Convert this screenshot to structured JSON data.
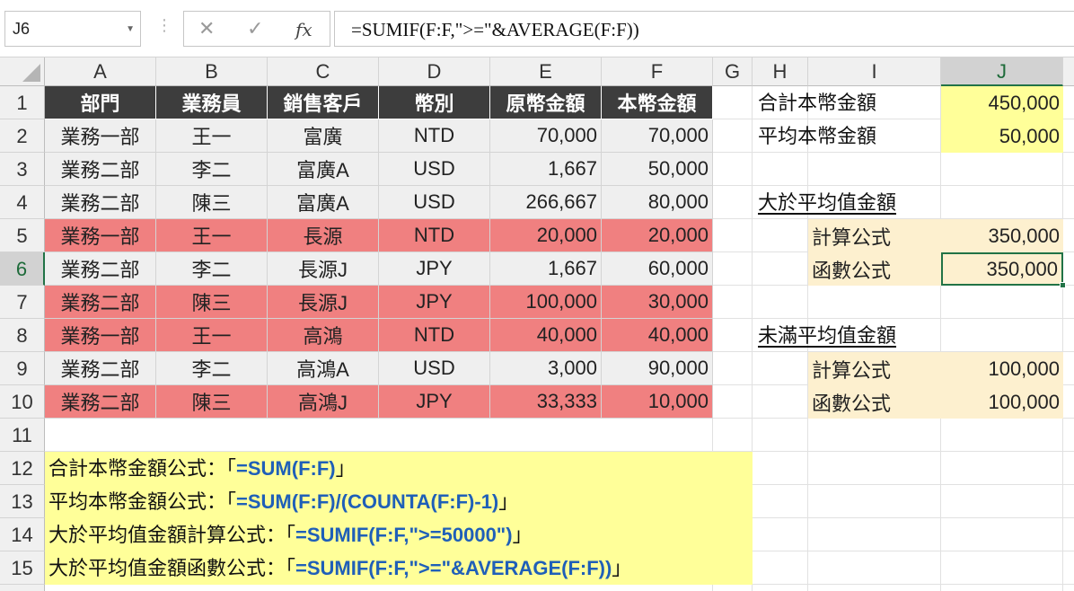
{
  "formula_bar": {
    "name_box": "J6",
    "cancel_icon": "✕",
    "enter_icon": "✓",
    "fx_label": "fx",
    "formula": "=SUMIF(F:F,\">=\"&AVERAGE(F:F))"
  },
  "columns": [
    "A",
    "B",
    "C",
    "D",
    "E",
    "F",
    "G",
    "H",
    "I",
    "J"
  ],
  "rows": [
    "1",
    "2",
    "3",
    "4",
    "5",
    "6",
    "7",
    "8",
    "9",
    "10",
    "11",
    "12",
    "13",
    "14",
    "15"
  ],
  "table": {
    "headers": [
      "部門",
      "業務員",
      "銷售客戶",
      "幣別",
      "原幣金額",
      "本幣金額"
    ],
    "data": [
      [
        "業務一部",
        "王一",
        "富廣",
        "NTD",
        "70,000",
        "70,000"
      ],
      [
        "業務二部",
        "李二",
        "富廣A",
        "USD",
        "1,667",
        "50,000"
      ],
      [
        "業務二部",
        "陳三",
        "富廣A",
        "USD",
        "266,667",
        "80,000"
      ],
      [
        "業務一部",
        "王一",
        "長源",
        "NTD",
        "20,000",
        "20,000"
      ],
      [
        "業務二部",
        "李二",
        "長源J",
        "JPY",
        "1,667",
        "60,000"
      ],
      [
        "業務二部",
        "陳三",
        "長源J",
        "JPY",
        "100,000",
        "30,000"
      ],
      [
        "業務一部",
        "王一",
        "高鴻",
        "NTD",
        "40,000",
        "40,000"
      ],
      [
        "業務二部",
        "李二",
        "高鴻A",
        "USD",
        "3,000",
        "90,000"
      ],
      [
        "業務二部",
        "陳三",
        "高鴻J",
        "JPY",
        "33,333",
        "10,000"
      ]
    ]
  },
  "summary": {
    "total_label": "合計本幣金額",
    "total_value": "450,000",
    "avg_label": "平均本幣金額",
    "avg_value": "50,000",
    "above_heading": "大於平均值金額",
    "above_calc_label": "計算公式",
    "above_calc_value": "350,000",
    "above_func_label": "函數公式",
    "above_func_value": "350,000",
    "below_heading": "未滿平均值金額",
    "below_calc_label": "計算公式",
    "below_calc_value": "100,000",
    "below_func_label": "函數公式",
    "below_func_value": "100,000"
  },
  "notes": [
    {
      "label": "合計本幣金額公式：「",
      "code": "=SUM(F:F)",
      "end": "」"
    },
    {
      "label": "平均本幣金額公式：「",
      "code": "=SUM(F:F)/(COUNTA(F:F)-1)",
      "end": "」"
    },
    {
      "label": "大於平均值金額計算公式：「",
      "code": "=SUMIF(F:F,\">=50000\")",
      "end": "」"
    },
    {
      "label": "大於平均值金額函數公式：「",
      "code": "=SUMIF(F:F,\">=\"&AVERAGE(F:F))",
      "end": "」"
    }
  ],
  "colors": {
    "header_fill": "#3d3d3d",
    "highlight_row": "#f08080",
    "grey_row": "#efefef",
    "yellow_fill": "#ffff99",
    "cream_fill": "#fdf0cf",
    "selection_green": "#217346",
    "formula_blue": "#1f5fb8"
  }
}
